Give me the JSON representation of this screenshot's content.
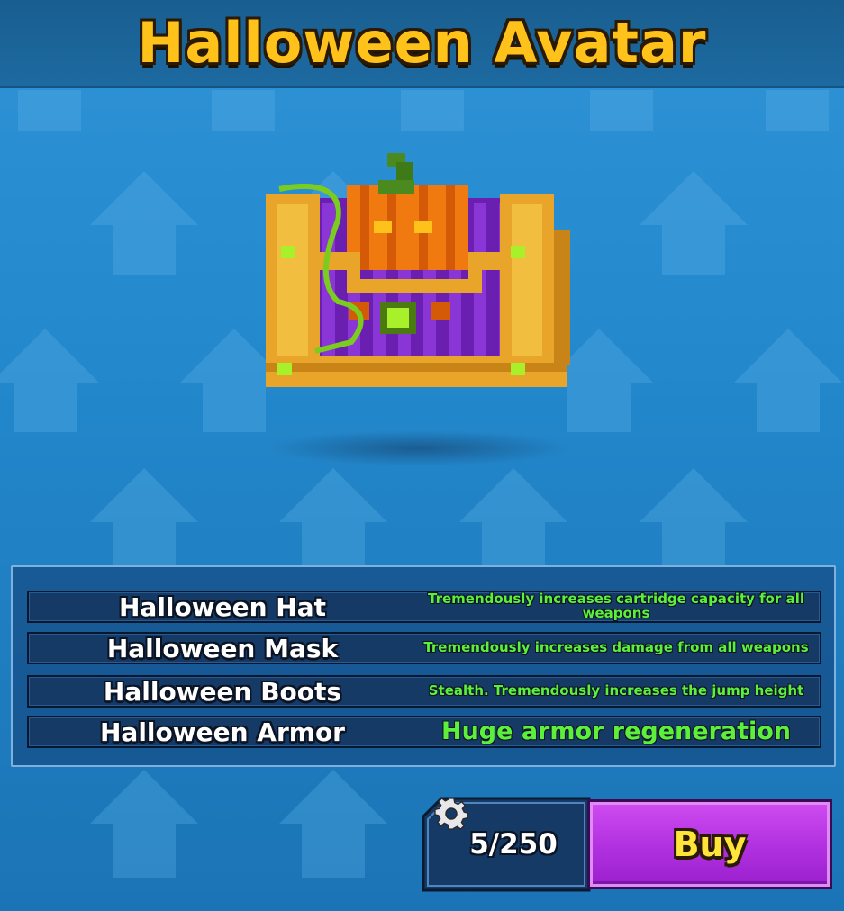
{
  "header": {
    "title": "Halloween Avatar"
  },
  "item": {
    "icon": "halloween-pumpkin-chest-icon"
  },
  "sets": [
    {
      "name": "Halloween Hat",
      "bonus": "Tremendously increases cartridge capacity for all weapons"
    },
    {
      "name": "Halloween Mask",
      "bonus": "Tremendously increases damage from all weapons"
    },
    {
      "name": "Halloween Boots",
      "bonus": "Stealth. Tremendously increases the jump height"
    },
    {
      "name": "Halloween Armor",
      "bonus": "Huge armor regeneration"
    }
  ],
  "purchase": {
    "currency_icon": "gear-icon",
    "price": "5/250",
    "buy_label": "Buy"
  },
  "colors": {
    "title": "#ffc21a",
    "bonus_text": "#5cf03a",
    "buy_button": "#b030e0",
    "buy_label": "#ffe43a"
  }
}
